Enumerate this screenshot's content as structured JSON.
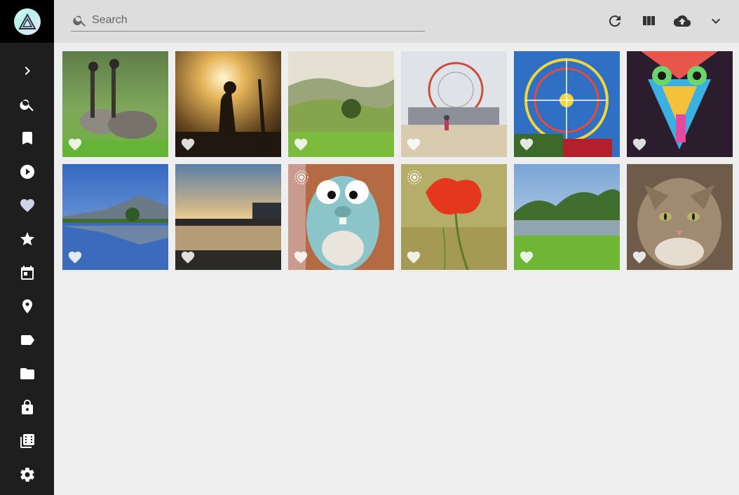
{
  "app": {
    "logo_icon": "triangle-logo-icon"
  },
  "sidebar": {
    "items": [
      {
        "name": "expand",
        "icon": "chevron-right-icon"
      },
      {
        "name": "search",
        "icon": "search-icon"
      },
      {
        "name": "albums",
        "icon": "bookmark-icon"
      },
      {
        "name": "videos",
        "icon": "play-circle-icon"
      },
      {
        "name": "favorites",
        "icon": "heart-icon"
      },
      {
        "name": "moments",
        "icon": "star-icon"
      },
      {
        "name": "calendar",
        "icon": "calendar-icon"
      },
      {
        "name": "places",
        "icon": "map-pin-icon"
      },
      {
        "name": "labels",
        "icon": "label-icon"
      },
      {
        "name": "folders",
        "icon": "folder-icon"
      },
      {
        "name": "private",
        "icon": "lock-icon"
      },
      {
        "name": "library",
        "icon": "film-folder-icon"
      },
      {
        "name": "settings",
        "icon": "gear-icon"
      }
    ]
  },
  "toolbar": {
    "search_placeholder": "Search",
    "buttons": [
      "refresh-icon",
      "view-columns-icon",
      "upload-cloud-icon",
      "chevron-down-icon"
    ]
  },
  "photos": [
    {
      "subject": "geese",
      "live": false
    },
    {
      "subject": "sunset-silhouette",
      "live": false
    },
    {
      "subject": "green-hills",
      "live": false
    },
    {
      "subject": "beach-ferris-wheel",
      "live": false
    },
    {
      "subject": "ferris-wheel",
      "live": false
    },
    {
      "subject": "colorful-mural",
      "live": false
    },
    {
      "subject": "mountain-lake",
      "live": false
    },
    {
      "subject": "river-sunset",
      "live": false
    },
    {
      "subject": "gopher-plush",
      "live": true
    },
    {
      "subject": "red-poppy",
      "live": true
    },
    {
      "subject": "pond-landscape",
      "live": false
    },
    {
      "subject": "tabby-cat",
      "live": false
    }
  ],
  "colors": {
    "sidebar": "#1e1e1e",
    "topbar": "#dddddd",
    "background": "#eeeeee"
  }
}
